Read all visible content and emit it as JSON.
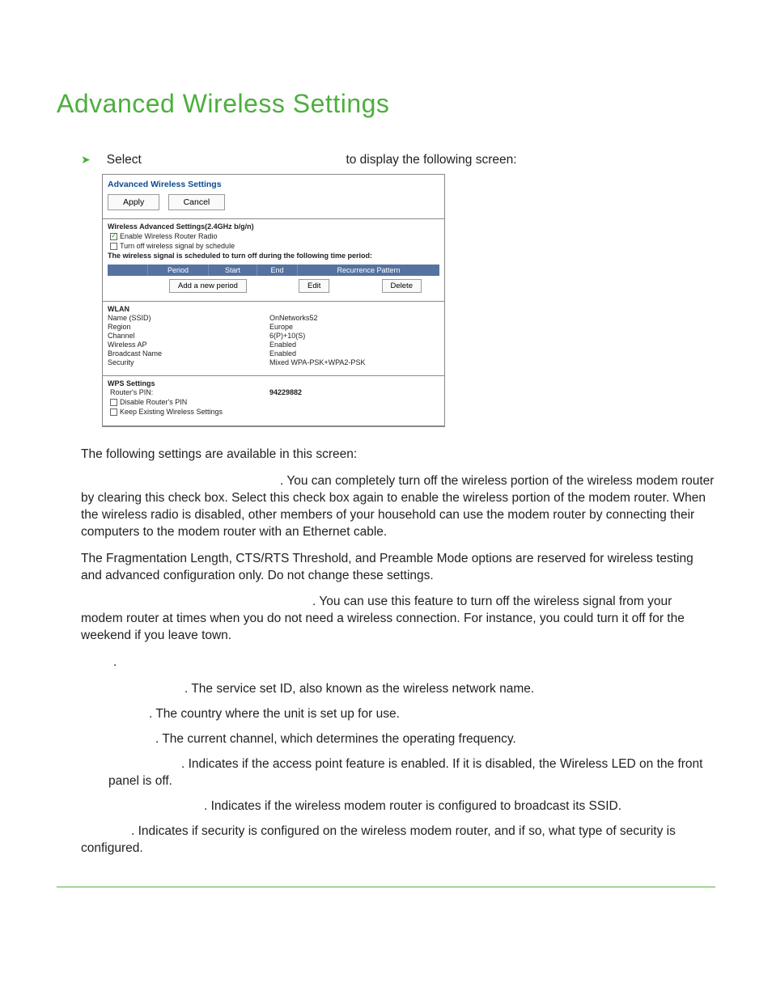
{
  "title": "Advanced Wireless Settings",
  "instruction": {
    "prefix": "Select",
    "suffix": " to display the following screen:"
  },
  "screenshot": {
    "heading": "Advanced Wireless Settings",
    "buttons": {
      "apply": "Apply",
      "cancel": "Cancel"
    },
    "adv": {
      "title": "Wireless Advanced Settings(2.4GHz b/g/n)",
      "enableRadio": "Enable Wireless Router Radio",
      "turnoff": "Turn off wireless signal by schedule",
      "scheduleNote": "The wireless signal is scheduled to turn off during the following time period:",
      "tableHeaders": {
        "period": "Period",
        "start": "Start",
        "end": "End",
        "recur": "Recurrence Pattern"
      },
      "tableButtons": {
        "add": "Add a new period",
        "edit": "Edit",
        "delete": "Delete"
      }
    },
    "wlan": {
      "title": "WLAN",
      "rows": {
        "nameLabel": "Name (SSID)",
        "nameValue": "OnNetworks52",
        "regionLabel": "Region",
        "regionValue": "Europe",
        "channelLabel": "Channel",
        "channelValue": "6(P)+10(S)",
        "apLabel": "Wireless AP",
        "apValue": "Enabled",
        "bcastLabel": "Broadcast Name",
        "bcastValue": "Enabled",
        "secLabel": "Security",
        "secValue": "Mixed WPA-PSK+WPA2-PSK"
      }
    },
    "wps": {
      "title": "WPS Settings",
      "pinLabel": "Router's PIN:",
      "pinValue": "94229882",
      "disablePin": "Disable Router's PIN",
      "keepExisting": "Keep Existing Wireless Settings"
    }
  },
  "intro": "The following settings are available in this screen:",
  "para1": ". You can completely turn off the wireless portion of the wireless modem router by clearing this check box. Select this check box again to enable the wireless portion of the modem router. When the wireless radio is disabled, other members of your household can use the modem router by connecting their computers to the modem router with an Ethernet cable.",
  "para2": "The Fragmentation Length, CTS/RTS Threshold, and Preamble Mode options are reserved for wireless testing and advanced configuration only. Do not change these settings.",
  "para3": ". You can use this feature to turn off the wireless signal from your modem router at times when you do not need a wireless connection. For instance, you could turn it off for the weekend if you leave town.",
  "dot": ".",
  "bullets": {
    "ssid": ". The service set ID, also known as the wireless network name.",
    "region": ". The country where the unit is set up for use.",
    "channel": ". The current channel, which determines the operating frequency.",
    "ap": ". Indicates if the access point feature is enabled. If it is disabled, the Wireless LED on the front panel is off.",
    "bcast": ". Indicates if the wireless modem router is configured to broadcast its SSID.",
    "sec": ". Indicates if security is configured on the wireless modem router, and if so, what type of security is configured."
  }
}
